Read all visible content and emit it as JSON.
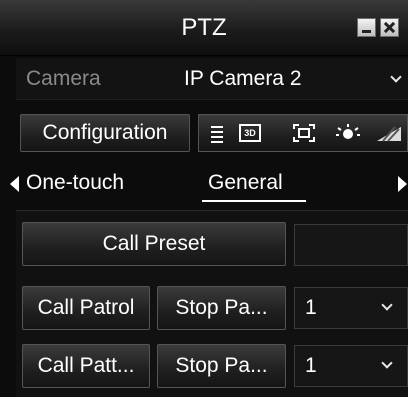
{
  "window": {
    "title": "PTZ"
  },
  "camera": {
    "label": "Camera",
    "value": "IP Camera 2"
  },
  "toolbar": {
    "configuration_label": "Configuration",
    "icons": [
      "list-icon",
      "3d-icon",
      "frame-icon",
      "light-icon",
      "wiper-icon"
    ],
    "icon_3d_text": "3D"
  },
  "tabs": [
    {
      "label": "One-touch",
      "active": false
    },
    {
      "label": "General",
      "active": true
    }
  ],
  "general": {
    "call_preset_label": "Call Preset",
    "preset_value": "",
    "call_patrol_label": "Call Patrol",
    "stop_patrol_label": "Stop Pa...",
    "patrol_select_value": "1",
    "call_pattern_label": "Call Patt...",
    "stop_pattern_label": "Stop Pa...",
    "pattern_select_value": "1"
  }
}
